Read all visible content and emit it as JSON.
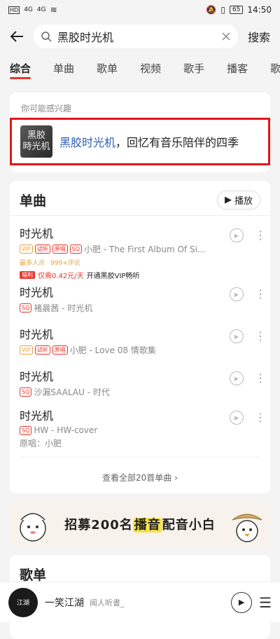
{
  "status": {
    "time": "14:50",
    "battery": "65",
    "signal_left": "4G",
    "signal_mid": "4G"
  },
  "search": {
    "query": "黑胶时光机",
    "submit": "搜索"
  },
  "tabs": [
    {
      "label": "综合",
      "active": true
    },
    {
      "label": "单曲"
    },
    {
      "label": "歌单"
    },
    {
      "label": "视频"
    },
    {
      "label": "歌手"
    },
    {
      "label": "播客"
    },
    {
      "label": "歌词"
    }
  ],
  "interest": {
    "label": "你可能感兴趣",
    "thumb_line1": "黑胶",
    "thumb_line2": "時光机",
    "title": "黑胶时光机",
    "subtitle": "，回忆有音乐陪伴的四季"
  },
  "songs_section": {
    "title": "单曲",
    "play_all": "播放",
    "view_all": "查看全部20首单曲",
    "songs": [
      {
        "title": "时光机",
        "tags": [
          "VIP",
          "试听",
          "原唱",
          "SQ"
        ],
        "meta": "小肥 - The First Album Of Si...",
        "stat1": "最多人点",
        "stat2": "999+评论",
        "fuli": "福利",
        "vip_price": "仅需0.42元/天",
        "vip_text": "开通黑胶VIP畅听"
      },
      {
        "title": "时光机",
        "tags": [
          "SQ"
        ],
        "meta": "褚晨茜 - 时光机"
      },
      {
        "title": "时光机",
        "tags": [
          "VIP",
          "试听",
          "原唱"
        ],
        "meta": "小肥 - Love 08 情歌集"
      },
      {
        "title": "时光机",
        "tags": [
          "SQ"
        ],
        "meta": "沙漏SAALAU - 时代"
      },
      {
        "title": "时光机",
        "tags": [
          "SQ"
        ],
        "meta": "HW - HW-cover",
        "original": "原唱：小肥"
      }
    ]
  },
  "banner": {
    "prefix": "招募200名",
    "highlight": "播音",
    "suffix": "配音小白"
  },
  "playlist_section": {
    "title": "歌单"
  },
  "now_playing": {
    "disc_label": "江湖",
    "title": "一笑江湖",
    "artist": "闻人听書_"
  },
  "colors": {
    "accent": "#e8362c",
    "highlight_blue": "#2e5fb6",
    "vip_gold": "#e8a33b"
  }
}
